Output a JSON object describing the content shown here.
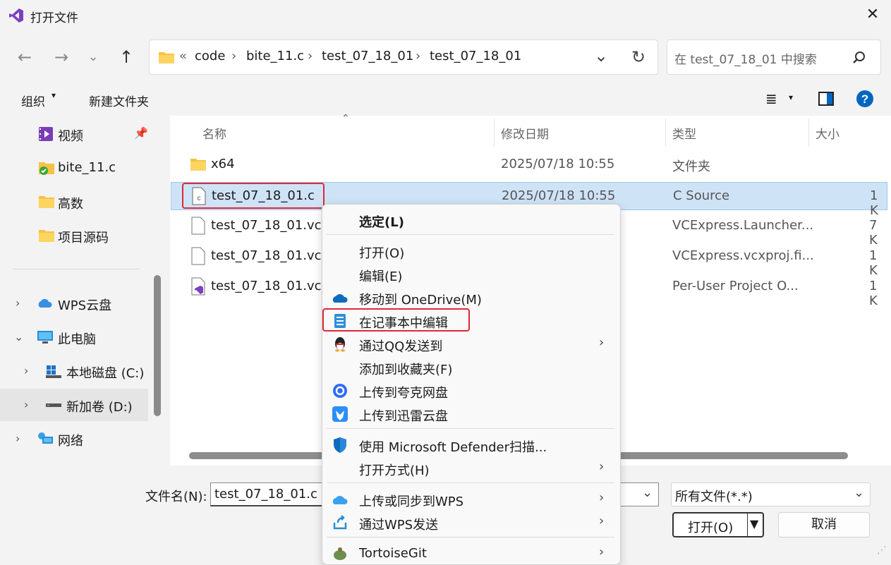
{
  "window": {
    "title": "打开文件",
    "close_symbol": "✕"
  },
  "address": {
    "overflow": "«",
    "crumbs": [
      "code",
      "bite_11.c",
      "test_07_18_01",
      "test_07_18_01"
    ],
    "separator": "›"
  },
  "search": {
    "placeholder": "在 test_07_18_01 中搜索"
  },
  "toolbar": {
    "organize": "组织",
    "new_folder": "新建文件夹"
  },
  "sidebar": {
    "quick": [
      {
        "label": "视频"
      },
      {
        "label": "bite_11.c"
      },
      {
        "label": "高数"
      },
      {
        "label": "项目源码"
      }
    ],
    "tree": [
      {
        "label": "WPS云盘"
      },
      {
        "label": "此电脑"
      },
      {
        "label": "本地磁盘 (C:)"
      },
      {
        "label": "新加卷 (D:)"
      },
      {
        "label": "网络"
      }
    ]
  },
  "columns": {
    "name": "名称",
    "date": "修改日期",
    "type": "类型",
    "size": "大小"
  },
  "files": [
    {
      "name": "x64",
      "date": "2025/07/18 10:55",
      "type": "文件夹",
      "size": ""
    },
    {
      "name": "test_07_18_01.c",
      "date": "2025/07/18 10:55",
      "type": "C Source",
      "size": "1 K"
    },
    {
      "name": "test_07_18_01.vcxp",
      "date": "",
      "type": "VCExpress.Launcher...",
      "size": "7 K"
    },
    {
      "name": "test_07_18_01.vcxp",
      "date": "",
      "type": "VCExpress.vcxproj.fi...",
      "size": "1 K"
    },
    {
      "name": "test_07_18_01.vcxp",
      "date": "",
      "type": "Per-User Project O...",
      "size": "1 K"
    }
  ],
  "footer": {
    "filename_label": "文件名(N):",
    "filename_value": "test_07_18_01.c",
    "filetype_value": "所有文件(*.*)",
    "open_label": "打开(O)",
    "cancel_label": "取消"
  },
  "context_menu": {
    "items": [
      {
        "label": "选定(L)"
      },
      {
        "label": "打开(O)"
      },
      {
        "label": "编辑(E)"
      },
      {
        "label": "移动到 OneDrive(M)"
      },
      {
        "label": "在记事本中编辑"
      },
      {
        "label": "通过QQ发送到"
      },
      {
        "label": "添加到收藏夹(F)"
      },
      {
        "label": "上传到夸克网盘"
      },
      {
        "label": "上传到迅雷云盘"
      },
      {
        "label": "使用 Microsoft Defender扫描..."
      },
      {
        "label": "打开方式(H)"
      },
      {
        "label": "上传或同步到WPS"
      },
      {
        "label": "通过WPS发送"
      },
      {
        "label": "TortoiseGit"
      }
    ]
  },
  "colors": {
    "accent": "#0067c0",
    "highlight": "#e0283a",
    "selection": "#cfe3f7",
    "folder": "#f5c342"
  }
}
